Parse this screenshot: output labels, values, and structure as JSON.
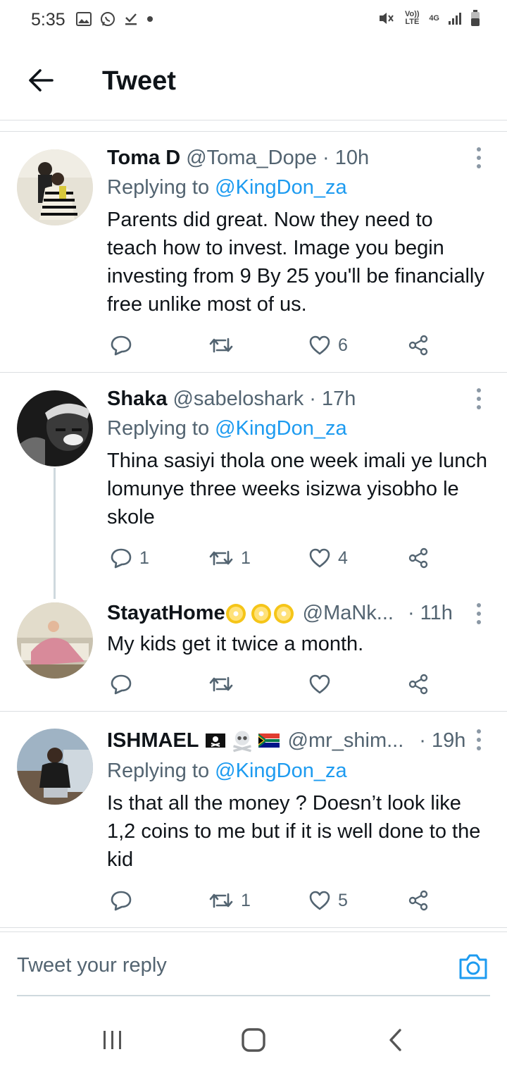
{
  "status_bar": {
    "time": "5:35",
    "volte_label": "Vo)) LTE",
    "network_label": "4G",
    "left_icons": [
      "gallery-icon",
      "whatsapp-icon",
      "download-done-icon",
      "dot-icon"
    ],
    "right_icons": [
      "mute-icon",
      "volte-icon",
      "network-4g-icon",
      "signal-icon",
      "battery-icon"
    ]
  },
  "header": {
    "title": "Tweet",
    "back_icon": "arrow-left-icon"
  },
  "tweets": [
    {
      "name": "Toma D",
      "handle": "@Toma_Dope",
      "time": "· 10h",
      "replying_prefix": "Replying to",
      "replying_to": "@KingDon_za",
      "body": "Parents did great. Now they need to teach how to invest. Image you begin investing from 9 By 25 you'll be financially free unlike most of us.",
      "reply_count": "",
      "retweet_count": "",
      "like_count": "6"
    },
    {
      "name": "Shaka",
      "handle": "@sabeloshark",
      "time": "· 17h",
      "replying_prefix": "Replying to",
      "replying_to": "@KingDon_za",
      "body": "Thina sasiyi thola one week imali ye lunch lomunye three weeks isizwa yisobho le skole",
      "reply_count": "1",
      "retweet_count": "1",
      "like_count": "4"
    },
    {
      "name": "StayatHome",
      "handle": "@MaNk...",
      "time": "· 11h",
      "name_emojis": [
        "dvd-emoji",
        "dvd-emoji",
        "dvd-emoji"
      ],
      "body": "My kids get it twice a month.",
      "reply_count": "",
      "retweet_count": "",
      "like_count": ""
    },
    {
      "name": "ISHMAEL",
      "handle": "@mr_shim...",
      "time": "· 19h",
      "name_emojis": [
        "pirate-flag-emoji",
        "skull-crossbones-emoji",
        "south-africa-flag-emoji"
      ],
      "replying_prefix": "Replying to",
      "replying_to": "@KingDon_za",
      "body": "Is that all the money ? Doesn’t look like 1,2 coins to me but if it is well done to the kid",
      "reply_count": "",
      "retweet_count": "1",
      "like_count": "5"
    }
  ],
  "reply_bar": {
    "placeholder": "Tweet your reply",
    "camera_icon": "camera-icon"
  },
  "nav_bar": {
    "buttons": [
      "recent-apps-icon",
      "home-icon",
      "back-icon"
    ]
  },
  "colors": {
    "link_blue": "#1d9bf0",
    "secondary_text": "#536471",
    "primary_text": "#0f1419",
    "divider": "#dcdfe2"
  }
}
